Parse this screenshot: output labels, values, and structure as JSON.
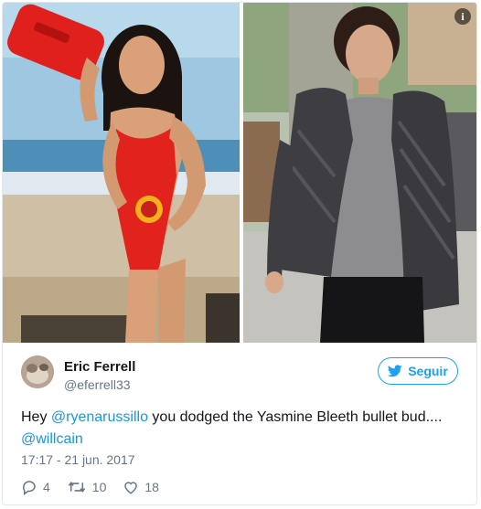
{
  "tweet": {
    "author": {
      "name": "Eric Ferrell",
      "handle": "@eferrell33"
    },
    "follow_label": "Seguir",
    "text": {
      "prefix": "Hey ",
      "mention1": "@ryenarussillo",
      "middle": " you dodged the Yasmine Bleeth bullet bud....",
      "mention2": "@willcain"
    },
    "timestamp": "17:17 - 21 jun. 2017",
    "replies": "4",
    "retweets": "10",
    "likes": "18",
    "info_badge": "i",
    "colors": {
      "accent": "#1da1f2",
      "link": "#1b95e0",
      "muted": "#657786"
    },
    "icons": [
      "info-icon",
      "twitter-bird-icon",
      "reply-icon",
      "retweet-icon",
      "like-icon"
    ],
    "images": [
      "photo-left-beach",
      "photo-right-street"
    ]
  }
}
